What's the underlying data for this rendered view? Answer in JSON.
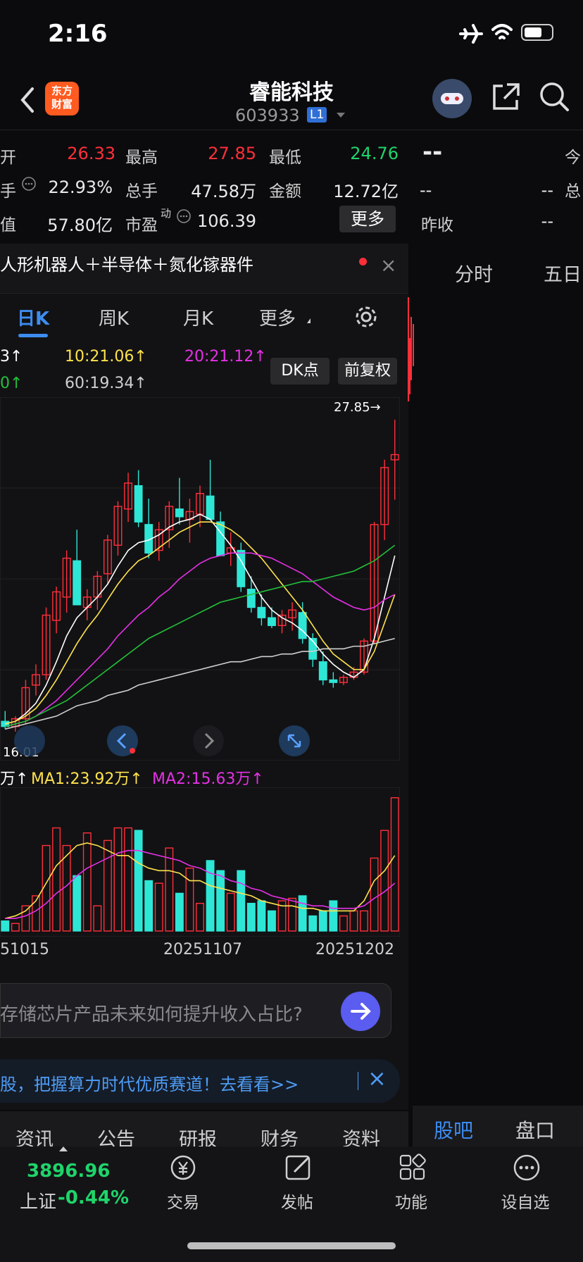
{
  "status": {
    "time": "2:16"
  },
  "header": {
    "title": "睿能科技",
    "code": "603933",
    "badge": "L1",
    "logo": "东方\n财富"
  },
  "quote": {
    "open_label": "开",
    "open": "26.33",
    "high_label": "最高",
    "high": "27.85",
    "low_label": "最低",
    "low": "24.76",
    "turnover_label": "手",
    "turnover": "22.93%",
    "volume_label": "总手",
    "volume": "47.58万",
    "amount_label": "金额",
    "amount": "12.72亿",
    "mcap_label": "值",
    "mcap": "57.80亿",
    "pe_label": "市盈",
    "pe_sup": "动",
    "pe": "106.39",
    "more_button": "更多",
    "right_dash": "--",
    "right_today": "今",
    "right_total": "总",
    "right_c1": "--",
    "right_c2": "--",
    "right_prev_label": "昨收",
    "right_prev": "--"
  },
  "concept": {
    "text": "人形机器人＋半导体＋氮化镓器件",
    "close": "×"
  },
  "k_tabs": [
    {
      "label": "日K"
    },
    {
      "label": "周K"
    },
    {
      "label": "月K"
    },
    {
      "label": "更多"
    }
  ],
  "ma_line1": {
    "a": "3↑",
    "b": "10:21.06↑",
    "c": "20:21.12↑"
  },
  "ma_line2": {
    "a": "0↑",
    "b": "60:19.34↑"
  },
  "chips": {
    "dk": "DK点",
    "fuquan": "前复权"
  },
  "price_marks": {
    "high": "27.85→",
    "low": "16.01"
  },
  "vol_ma": {
    "a": "万↑",
    "b": "MA1:23.92万↑",
    "c": "MA2:15.63万↑"
  },
  "vol_dates": [
    "51015",
    "20251107",
    "20251202"
  ],
  "right_tabs": {
    "fenshi": "分时",
    "wuri": "五日"
  },
  "ask": {
    "placeholder": "存储芯片产品未来如何提升收入占比?"
  },
  "banner": {
    "text": "股，把握算力时代优质赛道！去看看>>",
    "close": "×"
  },
  "bottom_tabs": [
    "资讯",
    "公告",
    "研报",
    "财务",
    "资料"
  ],
  "right_bottom_tabs": {
    "guba": "股吧",
    "pankou": "盘口"
  },
  "index": {
    "value": "3896.96",
    "name": "上证",
    "change": "-0.44%"
  },
  "nav": [
    {
      "label": "交易"
    },
    {
      "label": "发帖"
    },
    {
      "label": "功能"
    },
    {
      "label": "设自选"
    }
  ],
  "colors": {
    "up": "#ff2f3a",
    "down": "#2ee6d6",
    "accent": "#3d8cf0"
  },
  "chart_data": {
    "type": "candlestick",
    "candles": [
      [
        16.2,
        16.6,
        15.9,
        16.0
      ],
      [
        16.0,
        16.4,
        15.8,
        16.3
      ],
      [
        16.3,
        17.8,
        16.1,
        17.5
      ],
      [
        17.6,
        18.4,
        17.2,
        18.0
      ],
      [
        18.0,
        20.6,
        17.8,
        20.3
      ],
      [
        20.1,
        21.4,
        19.6,
        21.2
      ],
      [
        21.0,
        22.8,
        20.4,
        22.5
      ],
      [
        22.4,
        23.6,
        21.8,
        20.7
      ],
      [
        20.6,
        21.3,
        20.1,
        21.0
      ],
      [
        21.0,
        22.0,
        20.5,
        21.8
      ],
      [
        21.9,
        23.4,
        21.5,
        23.2
      ],
      [
        23.0,
        24.7,
        22.6,
        24.5
      ],
      [
        24.4,
        25.8,
        23.9,
        25.4
      ],
      [
        25.3,
        25.9,
        23.7,
        23.9
      ],
      [
        23.8,
        24.8,
        22.5,
        22.7
      ],
      [
        22.8,
        23.9,
        22.4,
        23.6
      ],
      [
        23.6,
        24.7,
        22.9,
        24.5
      ],
      [
        24.4,
        25.6,
        23.8,
        24.1
      ],
      [
        24.0,
        24.8,
        23.1,
        24.3
      ],
      [
        24.2,
        25.3,
        23.7,
        25.0
      ],
      [
        24.9,
        26.3,
        24.3,
        24.0
      ],
      [
        23.9,
        24.3,
        22.8,
        22.6
      ],
      [
        22.7,
        23.5,
        22.2,
        22.9
      ],
      [
        22.8,
        23.1,
        21.2,
        21.4
      ],
      [
        21.3,
        21.8,
        20.4,
        20.6
      ],
      [
        20.6,
        21.1,
        19.9,
        20.2
      ],
      [
        20.2,
        20.6,
        19.8,
        19.9
      ],
      [
        19.9,
        20.5,
        19.6,
        20.3
      ],
      [
        20.2,
        20.8,
        19.7,
        20.5
      ],
      [
        20.4,
        20.8,
        19.2,
        19.4
      ],
      [
        19.4,
        19.6,
        18.3,
        18.6
      ],
      [
        18.5,
        18.9,
        17.6,
        17.8
      ],
      [
        17.8,
        18.1,
        17.5,
        17.7
      ],
      [
        17.7,
        18.0,
        17.6,
        17.9
      ],
      [
        17.9,
        18.3,
        17.8,
        18.1
      ],
      [
        18.1,
        19.4,
        18.0,
        19.3
      ],
      [
        19.3,
        23.9,
        19.2,
        23.8
      ],
      [
        23.8,
        26.3,
        23.2,
        26.0
      ],
      [
        26.3,
        27.85,
        24.76,
        26.5
      ]
    ],
    "ylim": [
      15.5,
      28.5
    ],
    "series": [
      {
        "values": [
          16.1,
          16.2,
          16.5,
          16.9,
          17.6,
          18.5,
          19.5,
          20.2,
          20.6,
          21.0,
          21.5,
          22.2,
          22.8,
          23.1,
          23.2,
          23.4,
          23.7,
          23.9,
          24.0,
          24.2,
          24.0,
          23.5,
          23.0,
          22.4,
          21.7,
          21.0,
          20.5,
          20.2,
          20.0,
          19.7,
          19.3,
          18.8,
          18.4,
          18.1,
          17.9,
          18.2,
          19.4,
          21.0,
          22.6
        ]
      },
      {
        "values": [
          16.1,
          16.2,
          16.4,
          16.7,
          17.2,
          17.8,
          18.5,
          19.2,
          19.8,
          20.3,
          20.9,
          21.5,
          22.0,
          22.4,
          22.6,
          22.9,
          23.2,
          23.5,
          23.7,
          23.9,
          23.9,
          23.8,
          23.6,
          23.3,
          22.9,
          22.5,
          22.0,
          21.5,
          21.0,
          20.5,
          19.9,
          19.3,
          18.8,
          18.5,
          18.2,
          18.2,
          18.9,
          20.0,
          21.1
        ]
      },
      {
        "values": [
          16.0,
          16.1,
          16.2,
          16.4,
          16.7,
          17.0,
          17.4,
          17.8,
          18.2,
          18.6,
          19.0,
          19.5,
          19.9,
          20.3,
          20.6,
          21.0,
          21.3,
          21.7,
          22.0,
          22.3,
          22.5,
          22.6,
          22.7,
          22.7,
          22.7,
          22.6,
          22.5,
          22.3,
          22.1,
          21.9,
          21.6,
          21.3,
          21.0,
          20.8,
          20.6,
          20.5,
          20.6,
          20.9,
          21.1
        ]
      },
      {
        "values": [
          16.0,
          16.1,
          16.2,
          16.4,
          16.6,
          16.8,
          17.0,
          17.3,
          17.6,
          17.9,
          18.2,
          18.5,
          18.8,
          19.1,
          19.4,
          19.6,
          19.8,
          20.0,
          20.2,
          20.4,
          20.6,
          20.8,
          20.9,
          21.0,
          21.1,
          21.2,
          21.3,
          21.4,
          21.5,
          21.6,
          21.6,
          21.7,
          21.8,
          21.9,
          22.0,
          22.2,
          22.4,
          22.7,
          23.0
        ]
      },
      {
        "values": [
          15.9,
          16.0,
          16.1,
          16.2,
          16.3,
          16.4,
          16.6,
          16.8,
          16.9,
          17.0,
          17.2,
          17.3,
          17.4,
          17.6,
          17.7,
          17.8,
          17.9,
          18.0,
          18.1,
          18.2,
          18.3,
          18.4,
          18.5,
          18.5,
          18.6,
          18.7,
          18.7,
          18.8,
          18.8,
          18.9,
          18.9,
          19.0,
          19.0,
          19.0,
          19.1,
          19.1,
          19.2,
          19.3,
          19.4
        ]
      }
    ],
    "volume": [
      4,
      3,
      10,
      14,
      34,
      41,
      34,
      22,
      39,
      10,
      36,
      41,
      41,
      40,
      20,
      19,
      33,
      15,
      25,
      11,
      28,
      24,
      15,
      24,
      11,
      12,
      8,
      12,
      13,
      14,
      6,
      8,
      12,
      6,
      8,
      8,
      29,
      40,
      53
    ],
    "vol_ma1": [
      5,
      6,
      8,
      12,
      19,
      26,
      30,
      34,
      35,
      34,
      32,
      30,
      30,
      27,
      25,
      24,
      24,
      23,
      20,
      20,
      18,
      17,
      16,
      15,
      14,
      12,
      11,
      10,
      10,
      9,
      9,
      8,
      8,
      8,
      8,
      12,
      20,
      23.92,
      30
    ],
    "vol_ma2": [
      5,
      5,
      6,
      8,
      11,
      15,
      18,
      22,
      25,
      27,
      29,
      31,
      32,
      32,
      31,
      30,
      29,
      28,
      26,
      25,
      23,
      22,
      20,
      19,
      17,
      16,
      14,
      13,
      12,
      11,
      10,
      10,
      9,
      9,
      9,
      10,
      13,
      15.63,
      19
    ]
  }
}
